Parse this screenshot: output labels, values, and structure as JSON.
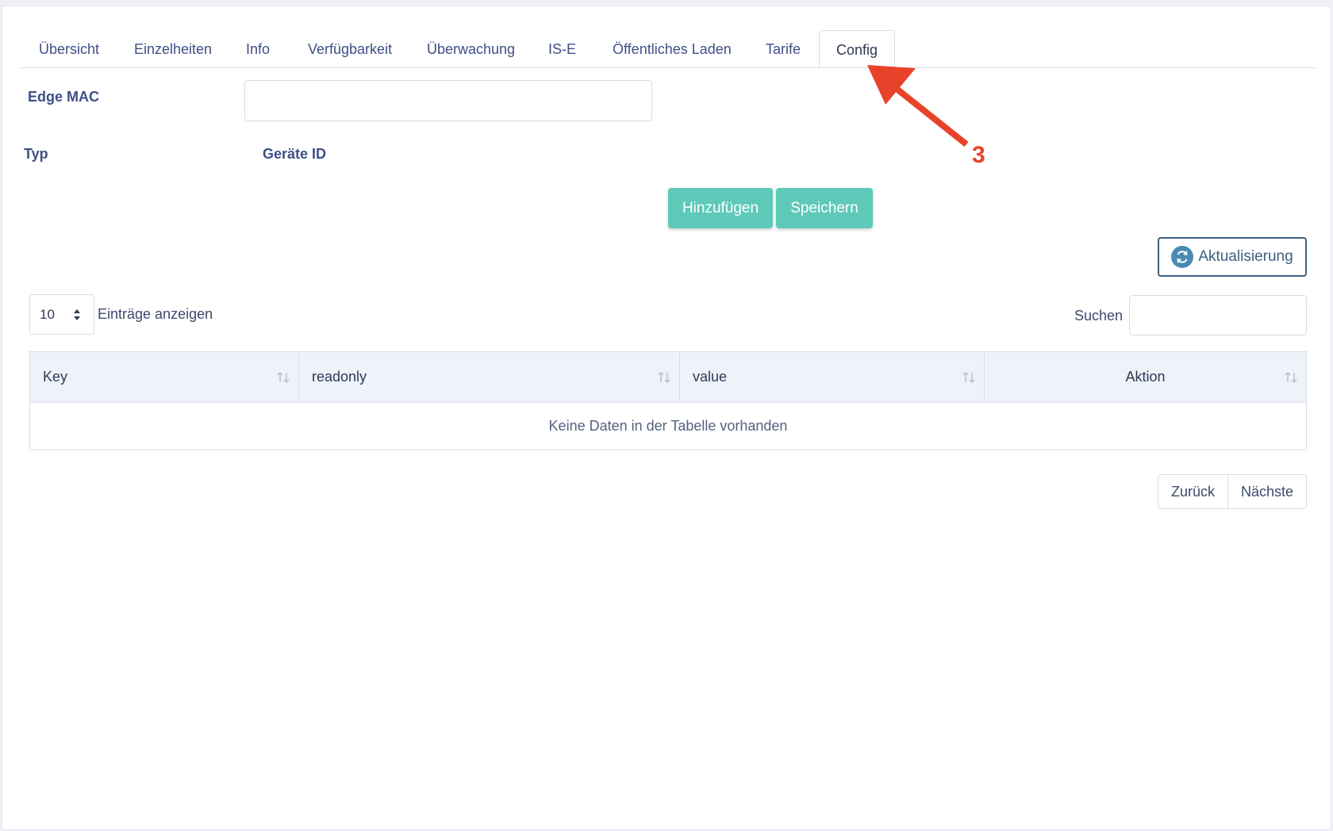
{
  "tabs": [
    {
      "label": "Übersicht"
    },
    {
      "label": "Einzelheiten"
    },
    {
      "label": "Info"
    },
    {
      "label": "Verfügbarkeit"
    },
    {
      "label": "Überwachung"
    },
    {
      "label": "IS-E"
    },
    {
      "label": "Öffentliches Laden"
    },
    {
      "label": "Tarife"
    },
    {
      "label": "Config",
      "active": true
    }
  ],
  "form": {
    "edge_mac_label": "Edge MAC",
    "edge_mac_value": "",
    "typ_label": "Typ",
    "geraete_id_label": "Geräte ID"
  },
  "actions": {
    "add_label": "Hinzufügen",
    "save_label": "Speichern",
    "refresh_label": "Aktualisierung"
  },
  "table_controls": {
    "page_length": "10",
    "length_suffix": "Einträge anzeigen",
    "search_label": "Suchen",
    "search_value": ""
  },
  "table": {
    "columns": [
      "Key",
      "readonly",
      "value",
      "Aktion"
    ],
    "empty_message": "Keine Daten in der Tabelle vorhanden"
  },
  "pagination": {
    "prev_label": "Zurück",
    "next_label": "Nächste"
  },
  "annotation": {
    "number": "3",
    "color": "#e8432a"
  },
  "colors": {
    "accent_teal": "#5ec9b8",
    "link_blue": "#3f4f86",
    "refresh_border": "#3d5f80"
  }
}
